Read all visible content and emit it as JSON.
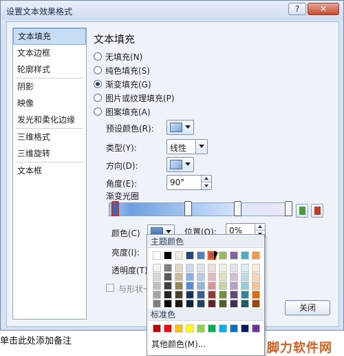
{
  "window": {
    "title": "设置文本效果格式",
    "help_label": "?",
    "close_label": "✕"
  },
  "nav": {
    "items": [
      {
        "label": "文本填充",
        "selected": true
      },
      {
        "label": "文本边框"
      },
      {
        "label": "轮廓样式"
      },
      {
        "label": "阴影"
      },
      {
        "label": "映像"
      },
      {
        "label": "发光和柔化边缘"
      },
      {
        "label": "三维格式"
      },
      {
        "label": "三维旋转"
      },
      {
        "label": "文本框"
      }
    ]
  },
  "panel": {
    "title": "文本填充",
    "fill_options": [
      {
        "label": "无填充(N)",
        "checked": false
      },
      {
        "label": "纯色填充(S)",
        "checked": false
      },
      {
        "label": "渐变填充(G)",
        "checked": true
      },
      {
        "label": "图片或纹理填充(P)",
        "checked": false
      },
      {
        "label": "图案填充(A)",
        "checked": false
      }
    ],
    "preset_label": "预设颜色(R):",
    "type_label": "类型(Y):",
    "type_value": "线性",
    "direction_label": "方向(D):",
    "angle_label": "角度(E):",
    "angle_value": "90°",
    "gradient_stops_label": "渐变光圈",
    "color_label": "颜色(C)",
    "position_label": "位置(O):",
    "position_value": "0%",
    "brightness_label": "亮度(I):",
    "transparency_label": "透明度(T)",
    "rotate_with_shape_label": "与形状一"
  },
  "buttons": {
    "close_label": "关闭"
  },
  "color_popup": {
    "theme_header": "主题颜色",
    "standard_header": "标准色",
    "other_label": "其他颜色(M)...",
    "theme_top_row": [
      "#ffffff",
      "#000000",
      "#eeece1",
      "#1f497d",
      "#4f81bd",
      "#c0504d",
      "#9bbb59",
      "#8064a2",
      "#4bacc6",
      "#f79646"
    ],
    "theme_shades": [
      [
        "#f2f2f2",
        "#7f7f7f",
        "#ddd9c3",
        "#c6d9f0",
        "#dbe5f1",
        "#f2dcdb",
        "#ebf1dd",
        "#e5e0ec",
        "#dbeef3",
        "#fdeada"
      ],
      [
        "#d8d8d8",
        "#595959",
        "#c4bd97",
        "#8db3e2",
        "#b8cce4",
        "#e5b9b7",
        "#d7e3bc",
        "#ccc1d9",
        "#b7dde8",
        "#fbd5b5"
      ],
      [
        "#bfbfbf",
        "#3f3f3f",
        "#938953",
        "#548dd4",
        "#95b3d7",
        "#d99694",
        "#c3d69b",
        "#b2a2c7",
        "#92cddc",
        "#fac08f"
      ],
      [
        "#a5a5a5",
        "#262626",
        "#494429",
        "#17365d",
        "#366092",
        "#953734",
        "#76923c",
        "#5f497a",
        "#31859b",
        "#e36c09"
      ],
      [
        "#7f7f7f",
        "#0c0c0c",
        "#1d1b10",
        "#0f243e",
        "#244061",
        "#632423",
        "#4f6128",
        "#3f3151",
        "#205867",
        "#974806"
      ]
    ],
    "standard_colors": [
      "#c00000",
      "#ff0000",
      "#ffc000",
      "#ffff00",
      "#92d050",
      "#00b050",
      "#00b0f0",
      "#0070c0",
      "#002060",
      "#7030a0"
    ]
  },
  "footer": {
    "prompt_text": "单击此处添加备注"
  },
  "watermark": {
    "text": "脚力软件网"
  }
}
